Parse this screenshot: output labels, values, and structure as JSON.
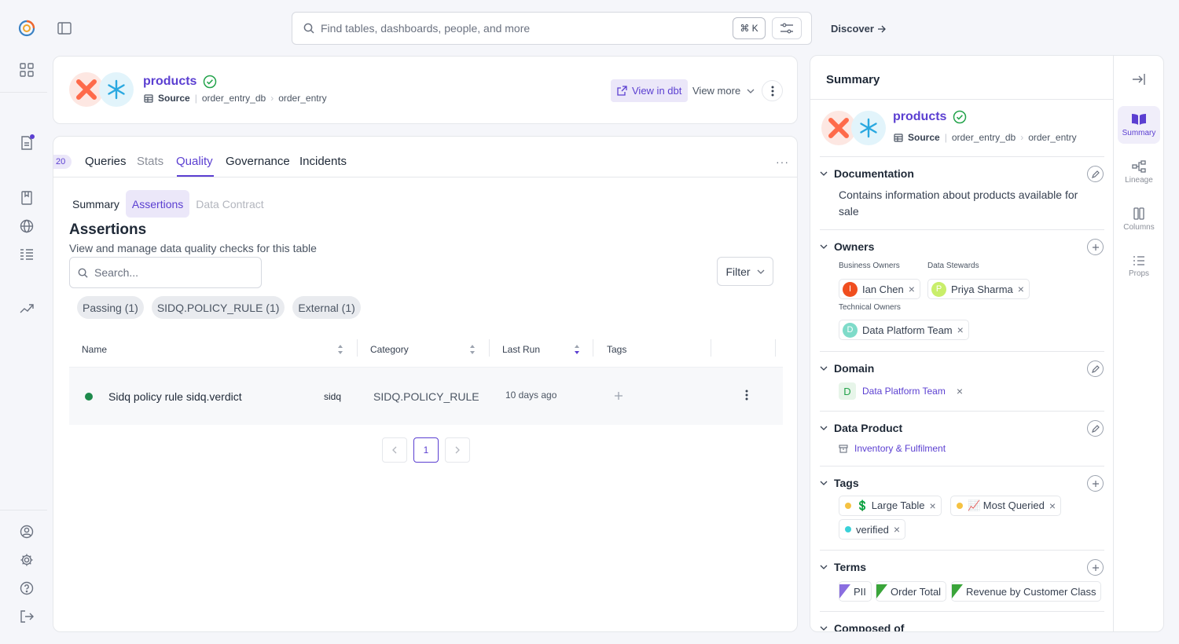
{
  "nav": {
    "icons": [
      "home-logo",
      "grid-icon",
      "document-icon",
      "book-icon",
      "globe-icon",
      "list-icon",
      "trend-icon",
      "user-icon",
      "gear-icon",
      "help-icon",
      "logout-icon"
    ]
  },
  "search": {
    "placeholder": "Find tables, dashboards, people, and more",
    "shortcut": "⌘ K",
    "discover": "Discover"
  },
  "entity": {
    "name": "products",
    "type": "Source",
    "db": "order_entry_db",
    "schema": "order_entry",
    "view_dbt": "View in dbt",
    "view_more": "View more"
  },
  "tabs": {
    "count": "20",
    "items": [
      "Queries",
      "Stats",
      "Quality",
      "Governance",
      "Incidents"
    ],
    "active": "Quality",
    "more": "···"
  },
  "subtabs": {
    "items": [
      "Summary",
      "Assertions",
      "Data Contract"
    ],
    "active": "Assertions"
  },
  "assertions": {
    "title": "Assertions",
    "subtitle": "View and manage data quality checks for this table",
    "search_placeholder": "Search...",
    "filter": "Filter",
    "chips": [
      "Passing (1)",
      "SIDQ.POLICY_RULE (1)",
      "External (1)"
    ],
    "columns": [
      "Name",
      "Category",
      "Last Run",
      "Tags"
    ],
    "rows": [
      {
        "name": "Sidq policy rule sidq.verdict",
        "source": "sidq",
        "category": "SIDQ.POLICY_RULE",
        "last_run": "10 days ago",
        "status_color": "#1e8a4c"
      }
    ],
    "page": "1"
  },
  "summary": {
    "title": "Summary",
    "name": "products",
    "type": "Source",
    "db": "order_entry_db",
    "schema": "order_entry",
    "rail": [
      "Summary",
      "Lineage",
      "Columns",
      "Props"
    ],
    "documentation": {
      "label": "Documentation",
      "text": "Contains information about products available for sale"
    },
    "owners": {
      "label": "Owners",
      "business_label": "Business Owners",
      "stewards_label": "Data Stewards",
      "technical_label": "Technical Owners",
      "business": [
        {
          "initial": "I",
          "name": "Ian Chen",
          "color": "#f04e1f"
        }
      ],
      "stewards": [
        {
          "initial": "P",
          "name": "Priya Sharma",
          "color": "#c9ee6a"
        }
      ],
      "technical": [
        {
          "initial": "D",
          "name": "Data Platform Team",
          "color": "#7edbc9"
        }
      ]
    },
    "domain": {
      "label": "Domain",
      "initial": "D",
      "name": "Data Platform Team"
    },
    "data_product": {
      "label": "Data Product",
      "name": "Inventory & Fulfilment"
    },
    "tags": {
      "label": "Tags",
      "items": [
        {
          "name": "💲 Large Table",
          "color": "#f5c242"
        },
        {
          "name": "📈 Most Queried",
          "color": "#f5c242"
        },
        {
          "name": "verified",
          "color": "#3ad1d8"
        }
      ]
    },
    "terms": {
      "label": "Terms",
      "items": [
        {
          "name": "PII",
          "color": "#8a6ee0"
        },
        {
          "name": "Order Total",
          "color": "#3aa53a"
        },
        {
          "name": "Revenue by Customer Class",
          "color": "#3aa53a"
        }
      ]
    },
    "composed_of": {
      "label": "Composed of"
    }
  }
}
